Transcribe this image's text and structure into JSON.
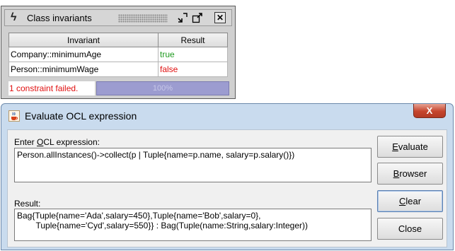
{
  "invariants_window": {
    "title": "Class invariants",
    "columns": [
      "Invariant",
      "Result"
    ],
    "rows": [
      {
        "invariant": "Company::minimumAge",
        "result": "true",
        "status_color": "#1f9a1f"
      },
      {
        "invariant": "Person::minimumWage",
        "result": "false",
        "status_color": "#e01010"
      }
    ],
    "status_message": "1 constraint failed.",
    "progress_text": "100%",
    "progress_fraction": 1.0,
    "icons": [
      "lightning-bolt-icon",
      "minimize-icon",
      "maximize-icon",
      "close-icon"
    ]
  },
  "ocl_dialog": {
    "title": "Evaluate OCL expression",
    "close_glyph": "X",
    "enter_label_prefix": "Enter ",
    "enter_label_mnemonic": "O",
    "enter_label_suffix": "CL expression:",
    "expression": "Person.allInstances()->collect(p | Tuple{name=p.name, salary=p.salary()})",
    "result_label": "Result:",
    "result_line1": "Bag{Tuple{name='Ada',salary=450},Tuple{name='Bob',salary=0},",
    "result_line2": "        Tuple{name='Cyd',salary=550}} : Bag(Tuple(name:String,salary:Integer))",
    "buttons": {
      "evaluate_mnemonic": "E",
      "evaluate_rest": "valuate",
      "browser_mnemonic": "B",
      "browser_rest": "rowser",
      "clear_mnemonic": "C",
      "clear_rest": "lear",
      "close": "Close"
    },
    "colors": {
      "titlebar": "#c9dbee",
      "close_button": "#c5452d",
      "progress": "#9c9cd0"
    }
  }
}
